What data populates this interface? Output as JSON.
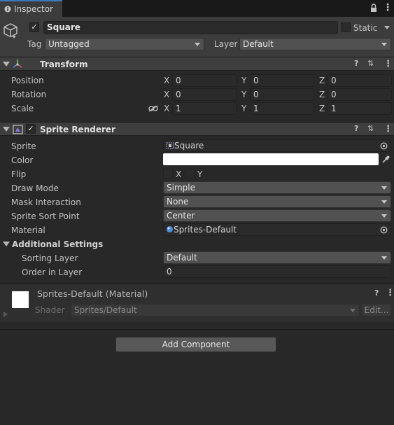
{
  "tab": {
    "label": "Inspector"
  },
  "gameobject": {
    "name": "Square",
    "static_label": "Static",
    "tag_label": "Tag",
    "tag_value": "Untagged",
    "layer_label": "Layer",
    "layer_value": "Default"
  },
  "transform": {
    "title": "Transform",
    "rows": [
      {
        "label": "Position",
        "x": "0",
        "y": "0",
        "z": "0"
      },
      {
        "label": "Rotation",
        "x": "0",
        "y": "0",
        "z": "0"
      },
      {
        "label": "Scale",
        "x": "1",
        "y": "1",
        "z": "1"
      }
    ],
    "axis": {
      "x": "X",
      "y": "Y",
      "z": "Z"
    }
  },
  "sprite_renderer": {
    "title": "Sprite Renderer",
    "sprite_label": "Sprite",
    "sprite_value": "Square",
    "color_label": "Color",
    "color_value": "#ffffff",
    "flip_label": "Flip",
    "flip_x": "X",
    "flip_y": "Y",
    "draw_mode_label": "Draw Mode",
    "draw_mode_value": "Simple",
    "mask_label": "Mask Interaction",
    "mask_value": "None",
    "sort_point_label": "Sprite Sort Point",
    "sort_point_value": "Center",
    "material_label": "Material",
    "material_value": "Sprites-Default",
    "additional_label": "Additional Settings",
    "sorting_layer_label": "Sorting Layer",
    "sorting_layer_value": "Default",
    "order_label": "Order in Layer",
    "order_value": "0"
  },
  "material": {
    "title": "Sprites-Default (Material)",
    "shader_label": "Shader",
    "shader_value": "Sprites/Default",
    "edit_label": "Edit..."
  },
  "add_component_label": "Add Component",
  "icons": {
    "lock": "lock-icon",
    "menu": "kebab-menu-icon",
    "help": "help-icon",
    "presets": "presets-icon"
  },
  "colors": {
    "accent": "#3a79bb",
    "background": "#282828",
    "header": "#3e3e3e"
  }
}
